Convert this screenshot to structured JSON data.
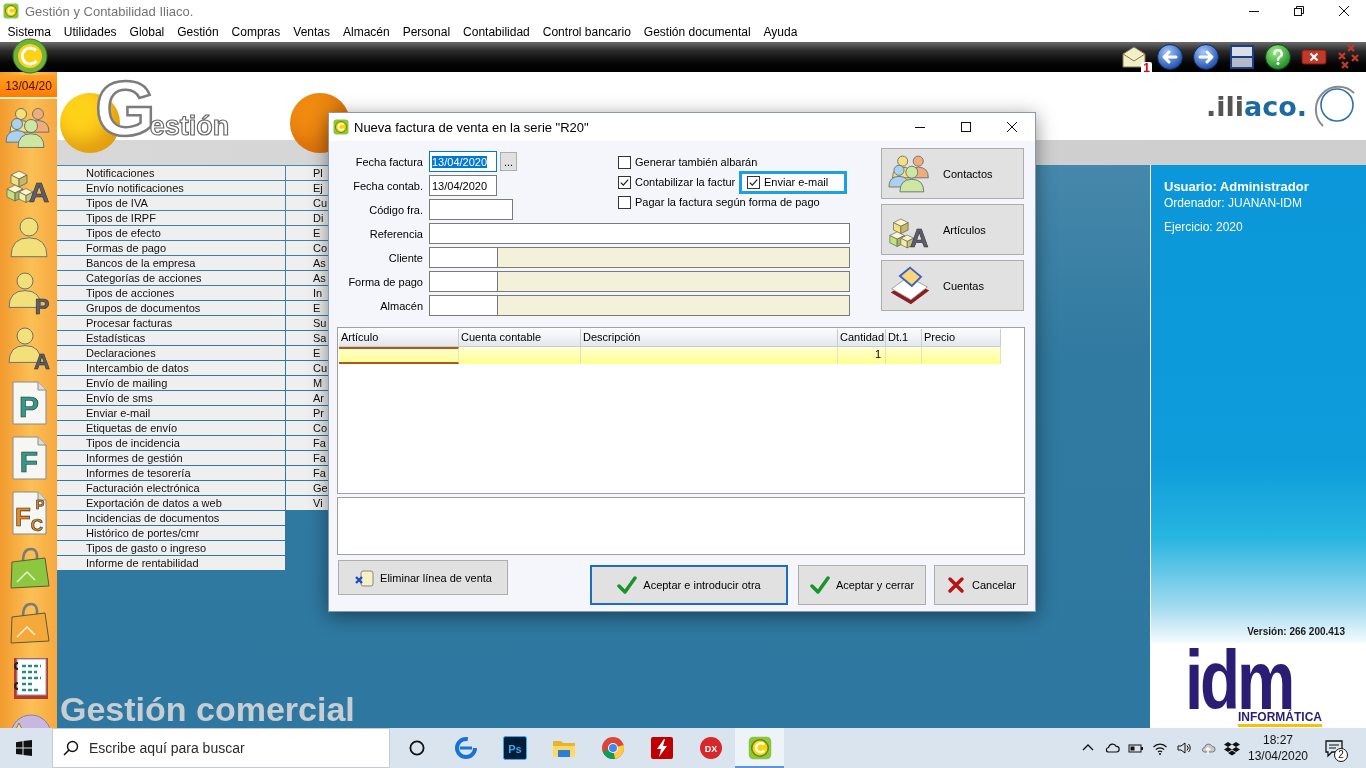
{
  "window": {
    "title": "Gestión y Contabilidad Iliaco."
  },
  "menu": [
    "Sistema",
    "Utilidades",
    "Global",
    "Gestión",
    "Compras",
    "Ventas",
    "Almacén",
    "Personal",
    "Contabilidad",
    "Control bancario",
    "Gestión documental",
    "Ayuda"
  ],
  "toolbar": {
    "mail_count": "1"
  },
  "sidebar": {
    "date": "13/04/20",
    "items": [
      {
        "kind": "people"
      },
      {
        "kind": "cubes",
        "letters": [
          "A"
        ]
      },
      {
        "kind": "person"
      },
      {
        "kind": "person",
        "letters": [
          "P"
        ]
      },
      {
        "kind": "person",
        "letters": [
          "A"
        ]
      },
      {
        "kind": "document",
        "letters": [
          "P"
        ]
      },
      {
        "kind": "document",
        "letters": [
          "F"
        ]
      },
      {
        "kind": "document",
        "letters": [
          "F",
          "P",
          "C"
        ]
      },
      {
        "kind": "bag",
        "color": "#8dc63f"
      },
      {
        "kind": "bag",
        "color": "#f4a93a"
      },
      {
        "kind": "notebook"
      },
      {
        "kind": "disc"
      }
    ]
  },
  "workspace": {
    "logos": [
      {
        "initial": "G",
        "text": "estión",
        "color": "#ffd21a"
      },
      {
        "color": "#f08a10"
      }
    ],
    "menu_columns": [
      [
        "Notificaciones",
        "Envío notificaciones",
        "Tipos de IVA",
        "Tipos de IRPF",
        "Tipos de efecto",
        "Formas de pago",
        "Bancos de la empresa",
        "Categorías de acciones",
        "Tipos de acciones",
        "Grupos de documentos",
        "Procesar facturas",
        "Estadísticas",
        "Declaraciones",
        "Intercambio de datos",
        "Envío de mailing",
        "Envío de sms",
        "Enviar e-mail",
        "Etiquetas de envío",
        "Tipos de incidencia",
        "Informes de gestión",
        "Informes de tesorería",
        "Facturación electrónica",
        "Exportación de datos a web",
        "Incidencias de documentos",
        "Histórico de portes/cmr",
        "Tipos de gasto o ingreso",
        "Informe de rentabilidad"
      ],
      [
        "Pl",
        "Ej",
        "Cu",
        "Di",
        "E",
        "Co",
        "As",
        "As",
        "In",
        "E",
        "Su",
        "Sa",
        "E",
        "Cu",
        "M",
        "Ar",
        "Pr",
        "Co",
        "Fa",
        "Fa",
        "Fa",
        "Ge",
        "Vi"
      ]
    ],
    "caption": "Gestión comercial"
  },
  "info_panel": {
    "logo": [
      ".ili",
      "aco."
    ],
    "user": "Usuario: Administrador",
    "computer": "Ordenador: JUANAN-IDM",
    "year": "Ejercicio: 2020",
    "version": "Versión: 266 200.413",
    "company": {
      "name": "idm",
      "tagline": "INFORMÁTICA"
    }
  },
  "dialog": {
    "title": "Nueva factura de venta en la serie \"R20\"",
    "fields": [
      {
        "label": "Fecha factura",
        "kind": "date",
        "value": "13/04/2020",
        "button": "...",
        "focused": true
      },
      {
        "label": "Fecha contab.",
        "kind": "date",
        "value": "13/04/2020",
        "focused": false
      },
      {
        "label": "Código fra.",
        "kind": "short",
        "focused": false
      },
      {
        "label": "Referencia",
        "kind": "wide",
        "focused": false
      },
      {
        "label": "Cliente",
        "kind": "lookup",
        "focused": false
      },
      {
        "label": "Forma de pago",
        "kind": "lookup",
        "focused": false
      },
      {
        "label": "Almacén",
        "kind": "lookup",
        "focused": false
      }
    ],
    "options": [
      {
        "label": "Generar también albarán",
        "checked": false
      },
      {
        "label": "Contabilizar la factur",
        "checked": true
      },
      {
        "label": "Pagar la factura según forma de pago",
        "checked": false
      }
    ],
    "highlight": {
      "label": "Enviar e-mail",
      "checked": true
    },
    "shortcuts": [
      {
        "label": "Contactos",
        "kind": "contacts"
      },
      {
        "label": "Artículos",
        "kind": "articles",
        "letters": [
          "A"
        ]
      },
      {
        "label": "Cuentas",
        "kind": "accounts"
      }
    ],
    "grid": {
      "columns": [
        {
          "label": "Artículo"
        },
        {
          "label": "Cuenta contable"
        },
        {
          "label": "Descripción"
        },
        {
          "label": "Cantidad"
        },
        {
          "label": "Dt.1"
        },
        {
          "label": "Precio"
        }
      ],
      "rows": [
        {
          "selected": true,
          "cells": [
            {
              "focused": true
            },
            {
              "focused": false
            },
            {
              "focused": false
            },
            {
              "text": "1",
              "focused": false
            },
            {
              "focused": false
            },
            {
              "focused": false
            }
          ]
        }
      ]
    },
    "buttons": [
      {
        "label": "Eliminar línea de venta",
        "kind": "delete",
        "default": false
      },
      {
        "label": "Aceptar e introducir otra",
        "kind": "accept",
        "default": true
      },
      {
        "label": "Aceptar y cerrar",
        "kind": "accept",
        "default": false
      },
      {
        "label": "Cancelar",
        "kind": "cancel",
        "default": false
      }
    ]
  },
  "taskbar": {
    "search": {
      "placeholder": "Escribe aquí para buscar"
    },
    "apps": [
      {
        "kind": "ring",
        "selected": false
      },
      {
        "kind": "browser",
        "selected": false
      },
      {
        "kind": "tile",
        "glyph": "Ps",
        "selected": false
      },
      {
        "kind": "folder",
        "selected": false
      },
      {
        "kind": "wheel",
        "selected": false
      },
      {
        "kind": "bolt",
        "selected": false
      },
      {
        "kind": "disc",
        "glyph": "DX",
        "selected": false
      },
      {
        "kind": "app",
        "selected": true
      }
    ],
    "time": "18:27",
    "date": "13/04/2020",
    "notifications": "2"
  }
}
